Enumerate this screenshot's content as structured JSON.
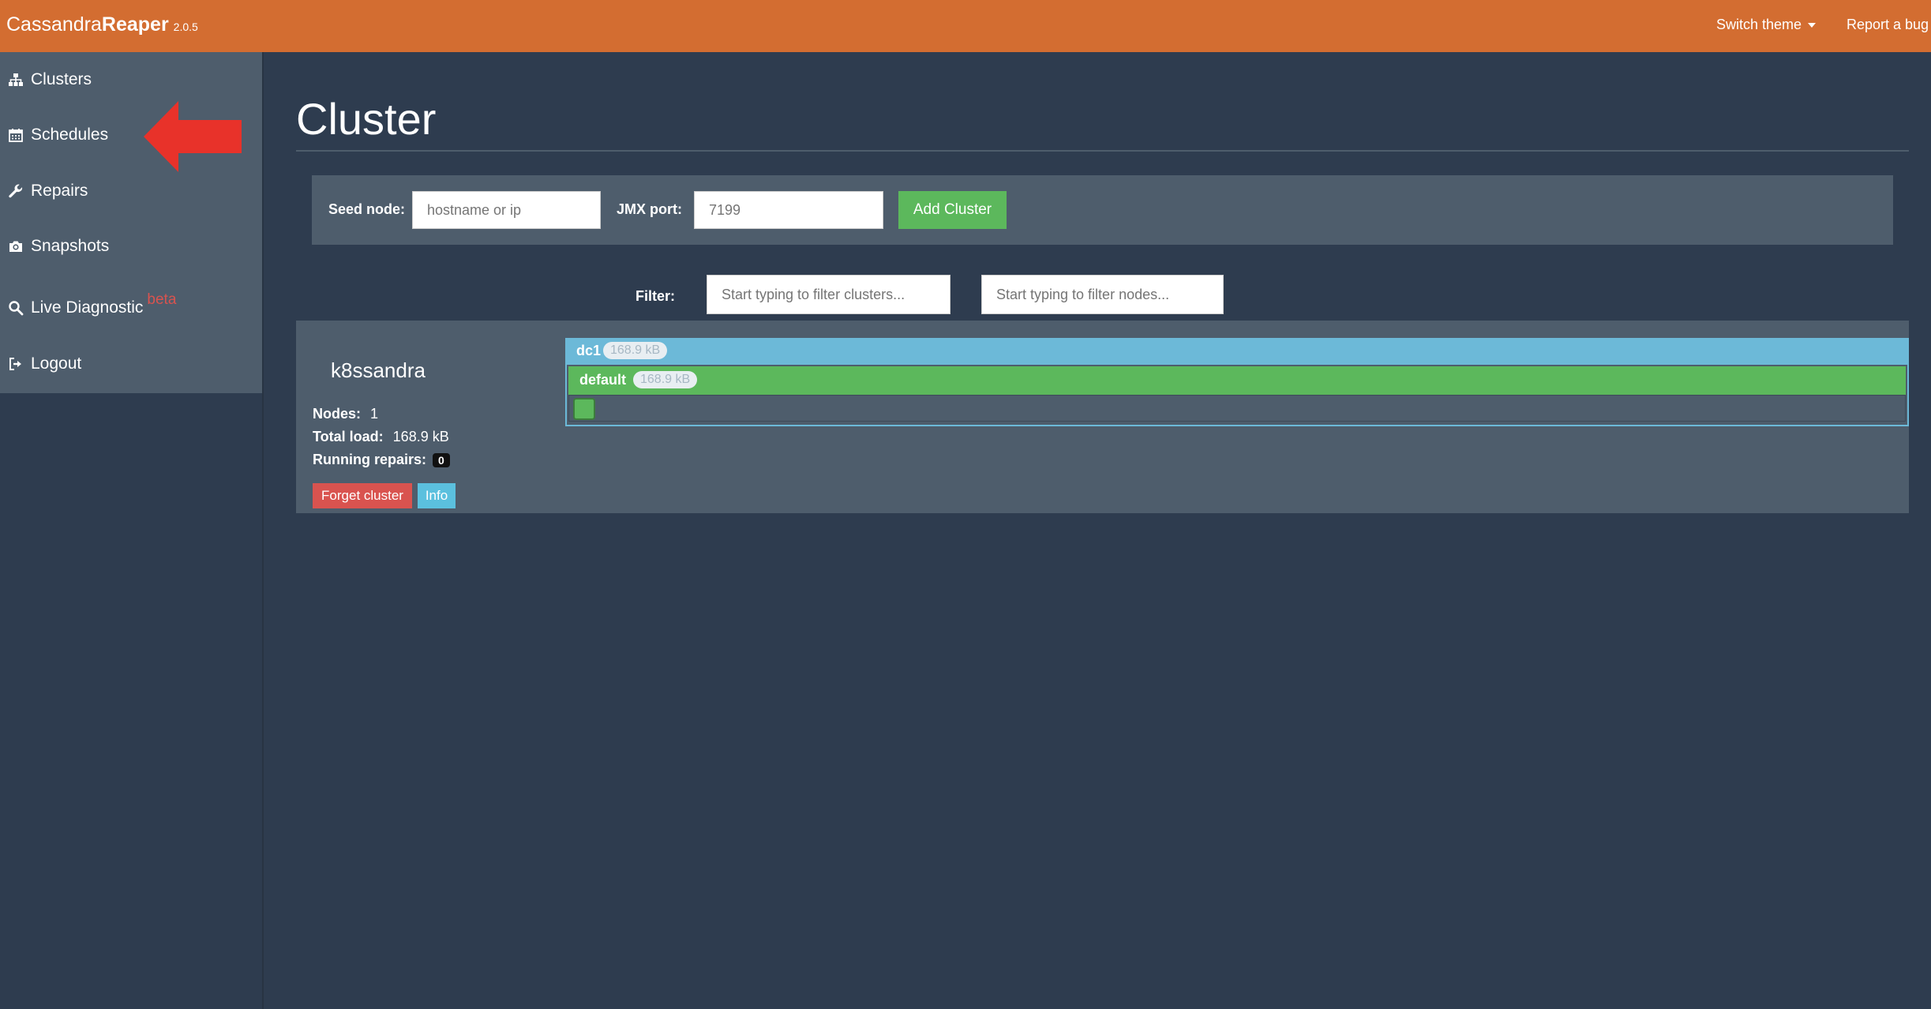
{
  "brand": {
    "name_light": "Cassandra",
    "name_bold": "Reaper",
    "version": "2.0.5"
  },
  "navbar": {
    "switch_theme": "Switch theme",
    "report_bug": "Report a bug"
  },
  "sidebar": {
    "items": [
      {
        "label": "Clusters",
        "icon": "sitemap-icon"
      },
      {
        "label": "Schedules",
        "icon": "calendar-icon"
      },
      {
        "label": "Repairs",
        "icon": "wrench-icon"
      },
      {
        "label": "Snapshots",
        "icon": "camera-icon"
      },
      {
        "label": "Live Diagnostic",
        "icon": "search-icon",
        "tag": "beta"
      },
      {
        "label": "Logout",
        "icon": "logout-icon"
      }
    ]
  },
  "main": {
    "title": "Cluster",
    "add_cluster": {
      "seed_label": "Seed node:",
      "seed_placeholder": "hostname or ip",
      "jmx_label": "JMX port:",
      "jmx_placeholder": "7199",
      "button": "Add Cluster"
    },
    "filter": {
      "label": "Filter:",
      "clusters_placeholder": "Start typing to filter clusters...",
      "nodes_placeholder": "Start typing to filter nodes..."
    },
    "cluster": {
      "name": "k8ssandra",
      "nodes_label": "Nodes:",
      "nodes_value": "1",
      "load_label": "Total load:",
      "load_value": "168.9 kB",
      "repairs_label": "Running repairs:",
      "repairs_value": "0",
      "forget_button": "Forget cluster",
      "info_button": "Info",
      "datacenter": {
        "name": "dc1",
        "load": "168.9 kB"
      },
      "rack": {
        "name": "default",
        "load": "168.9 kB"
      }
    }
  },
  "colors": {
    "navbar": "#d36d31",
    "background": "#2e3c4f",
    "panel": "#4e5d6c",
    "success": "#5cb85c",
    "danger": "#d9534f",
    "info": "#5bc0de",
    "annotation_arrow": "#e8322a"
  }
}
